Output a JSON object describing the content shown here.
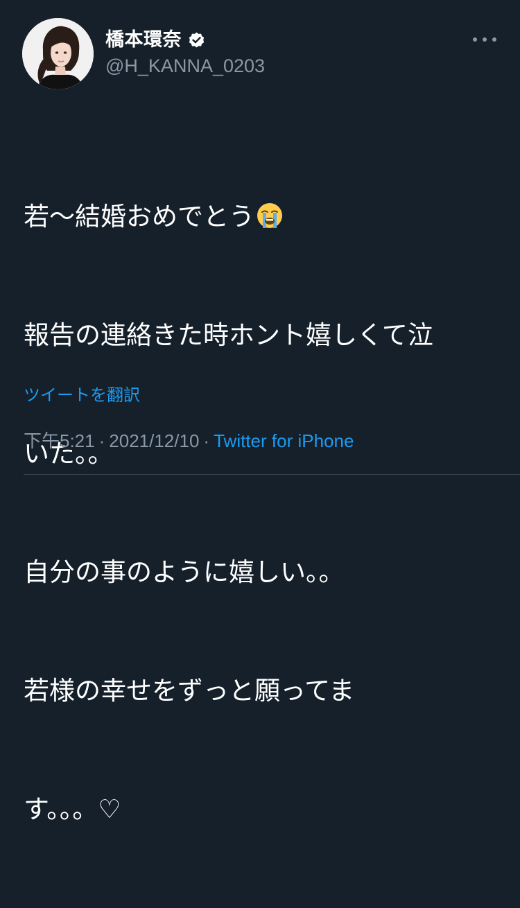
{
  "user": {
    "display_name": "橋本環奈",
    "handle": "@H_KANNA_0203",
    "verified": true,
    "avatar_icon": "profile-photo"
  },
  "tweet": {
    "lines": [
      "若〜結婚おめでとう",
      "報告の連絡きた時ホント嬉しくて泣",
      "いた。。",
      "自分の事のように嬉しい。。",
      "若様の幸せをずっと願ってま",
      "す。。。♡"
    ],
    "emoji": "loudly-crying-face"
  },
  "translate_label": "ツイートを翻訳",
  "meta": {
    "time": "下午5:21",
    "separator": "·",
    "date": "2021/12/10",
    "source": "Twitter for iPhone"
  },
  "colors": {
    "background": "#15202b",
    "accent": "#1d9bf0",
    "secondary_text": "#8b98a5"
  },
  "icons": {
    "more": "more-horizontal-icon",
    "verified": "verified-badge-icon"
  }
}
